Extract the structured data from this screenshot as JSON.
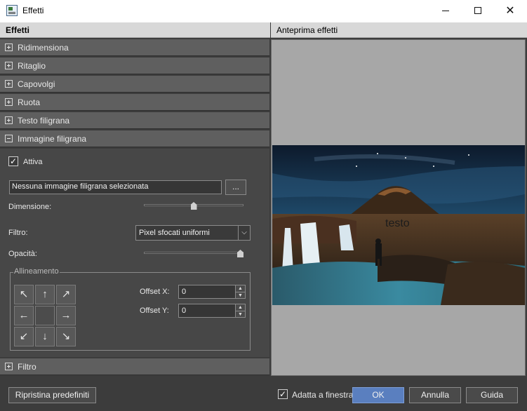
{
  "window": {
    "title": "Effetti",
    "min_icon": "minimize-icon",
    "max_icon": "maximize-icon",
    "close_glyph": "✕"
  },
  "left_panel": {
    "header": "Effetti",
    "sections": [
      {
        "label": "Ridimensiona",
        "expanded": false
      },
      {
        "label": "Ritaglio",
        "expanded": false
      },
      {
        "label": "Capovolgi",
        "expanded": false
      },
      {
        "label": "Ruota",
        "expanded": false
      },
      {
        "label": "Testo filigrana",
        "expanded": false
      },
      {
        "label": "Immagine filigrana",
        "expanded": true
      },
      {
        "label": "Filtro",
        "expanded": false
      }
    ]
  },
  "watermark_image": {
    "active_label": "Attiva",
    "active_checked": true,
    "check_glyph": "✓",
    "image_field": "Nessuna immagine filigrana selezionata",
    "browse_label": "...",
    "size_label": "Dimensione:",
    "size_value": 0.5,
    "filter_label": "Filtro:",
    "filter_value": "Pixel sfocati uniformi",
    "dropdown_glyph": "⌵",
    "opacity_label": "Opacità:",
    "opacity_value": 1.0,
    "alignment": {
      "legend": "Allineamento",
      "buttons": [
        "↖",
        "↑",
        "↗",
        "←",
        "",
        "→",
        "↙",
        "↓",
        "↘"
      ]
    },
    "offset_x_label": "Offset X:",
    "offset_x_value": "0",
    "offset_y_label": "Offset Y:",
    "offset_y_value": "0",
    "spin_up": "▲",
    "spin_down": "▼"
  },
  "preview": {
    "header": "Anteprima effetti",
    "watermark_text": "testo"
  },
  "footer": {
    "reset_label": "Ripristina predefiniti",
    "fit_label": "Adatta a finestra",
    "fit_checked": true,
    "ok_label": "OK",
    "cancel_label": "Annulla",
    "help_label": "Guida"
  },
  "colors": {
    "panel_bg": "#3c3c3c",
    "section_bg": "#5f5f5f",
    "ok_blue": "#5a7fbf",
    "preview_bg": "#a7a7a7"
  }
}
